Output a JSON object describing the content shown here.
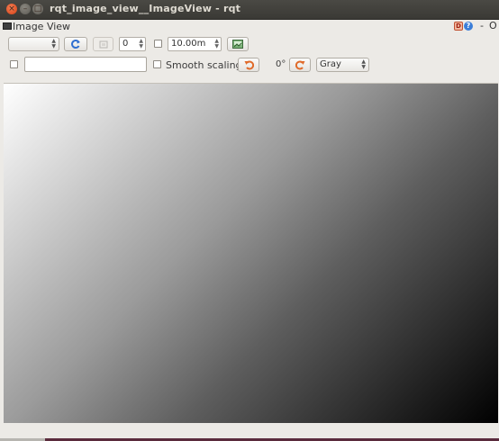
{
  "window": {
    "title": "rqt_image_view__ImageView - rqt"
  },
  "plugin": {
    "title": "Image View",
    "dash": "-",
    "o_label": "O",
    "help_icon": "help-icon",
    "d_icon": "D"
  },
  "toolbar_row1": {
    "topic_combo_value": "",
    "refresh_icon": "refresh-icon",
    "zoom_icon": "zoom-fit-icon",
    "rotation_spin_value": "0",
    "duration_value": "10.00m",
    "save_icon": "save-image-icon"
  },
  "toolbar_row2": {
    "mouse_topic_value": "",
    "smooth_scaling_label": "Smooth scaling",
    "rotate_left_icon": "rotate-left-icon",
    "rotation_value": "0°",
    "rotate_right_icon": "rotate-right-icon",
    "color_scheme_value": "Gray"
  },
  "colors": {
    "accent_orange": "#e06a2a",
    "titlebar": "#3c3b37"
  }
}
